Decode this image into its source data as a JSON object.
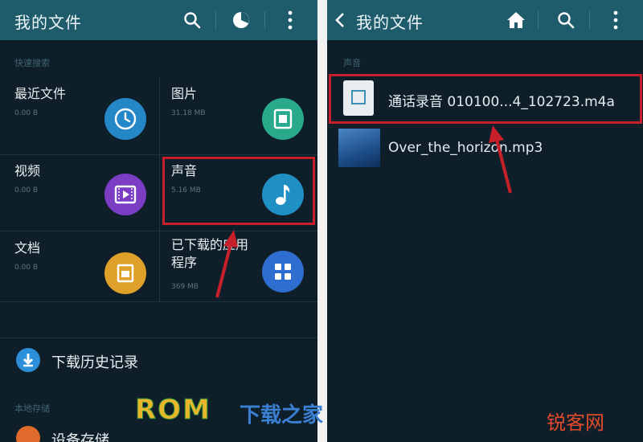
{
  "left_screen": {
    "title": "我的文件",
    "quick_search_label": "快速搜索",
    "categories": [
      {
        "name": "最近文件",
        "size": "0.00 B",
        "icon": "clock-icon",
        "color": "#2488c8"
      },
      {
        "name": "图片",
        "size": "31.18 MB",
        "icon": "image-icon",
        "color": "#27a98a"
      },
      {
        "name": "视频",
        "size": "0.00 B",
        "icon": "video-icon",
        "color": "#7b3dc4"
      },
      {
        "name": "声音",
        "size": "5.16 MB",
        "icon": "music-note-icon",
        "color": "#1f8fc4"
      },
      {
        "name": "文档",
        "size": "0.00 B",
        "icon": "document-icon",
        "color": "#e0a12b"
      },
      {
        "name": "已下载的应用程序",
        "size": "369 MB",
        "icon": "apps-grid-icon",
        "color": "#2e6ed0"
      }
    ],
    "download_history_label": "下载历史记录",
    "local_storage_label": "本地存储",
    "device_storage_label": "设备存储"
  },
  "right_screen": {
    "title": "我的文件",
    "section_label": "声音",
    "files": [
      {
        "name": "通话录音 010100...4_102723.m4a"
      },
      {
        "name": "Over_the_horizon.mp3"
      }
    ]
  },
  "watermarks": {
    "rom_text": "ROM",
    "download_text": "下载之家",
    "site_text": "锐客网"
  },
  "colors": {
    "app_bar": "#1e5b6b",
    "background": "#0f1f29",
    "highlight": "#c8202a"
  }
}
